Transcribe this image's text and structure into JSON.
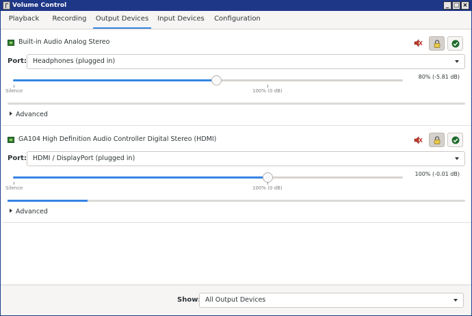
{
  "window": {
    "title": "Volume Control"
  },
  "tabs": [
    {
      "label": "Playback"
    },
    {
      "label": "Recording"
    },
    {
      "label": "Output Devices",
      "active": true
    },
    {
      "label": "Input Devices"
    },
    {
      "label": "Configuration"
    }
  ],
  "devices": [
    {
      "name": "Built-in Audio Analog Stereo",
      "port_label": "Port:",
      "port_value": "Headphones (plugged in)",
      "volume_text": "80% (-5.81 dB)",
      "volume_fraction": 0.8,
      "mark_silence": "Silence",
      "mark_100": "100% (0 dB)",
      "peak_fraction": 0.0,
      "advanced_label": "Advanced"
    },
    {
      "name": "GA104 High Definition Audio Controller Digital Stereo (HDMI)",
      "port_label": "Port:",
      "port_value": "HDMI / DisplayPort (plugged in)",
      "volume_text": "100% (-0.01 dB)",
      "volume_fraction": 1.0,
      "mark_silence": "Silence",
      "mark_100": "100% (0 dB)",
      "peak_fraction": 0.175,
      "advanced_label": "Advanced"
    }
  ],
  "footer": {
    "show_label": "Show:",
    "show_value": "All Output Devices"
  },
  "icons": {
    "mute": "speaker-mute-icon",
    "lock": "lock-icon",
    "default": "checkmark-icon"
  },
  "colors": {
    "accent": "#3584e4",
    "titlebar": "#1f3787"
  }
}
